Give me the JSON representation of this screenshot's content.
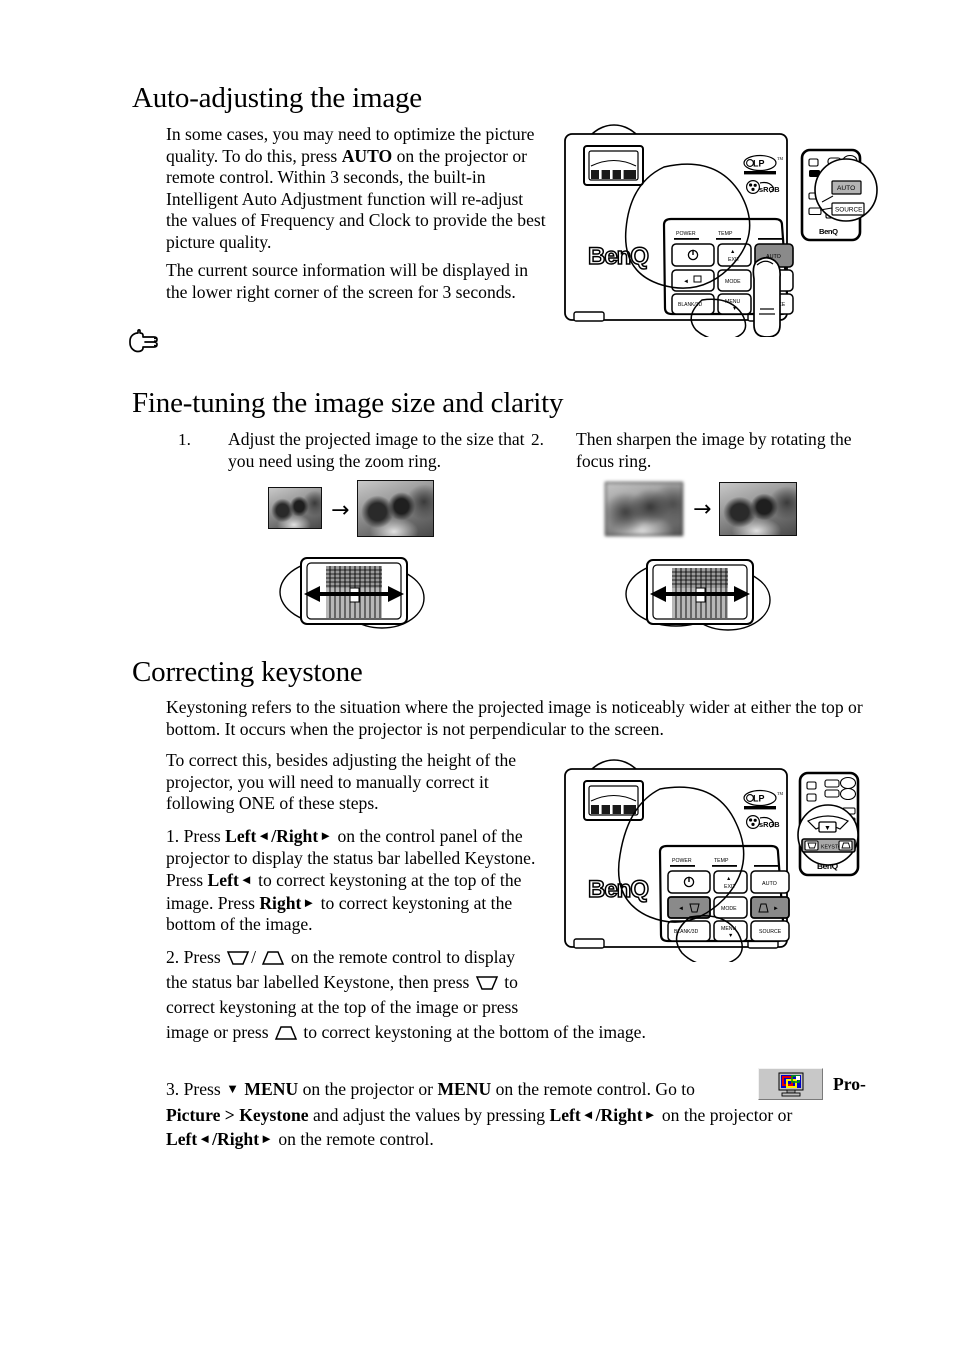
{
  "document": {
    "type": "projector-user-manual-page",
    "product_brand": "BenQ"
  },
  "sections": [
    {
      "id": "auto-adjusting",
      "title": "Auto-adjusting the image",
      "paragraphs": [
        "In some cases, you may need to optimize the picture quality. To do this, press AUTO on the projector or remote control. Within 3 seconds, the built-in Intelligent Auto Adjustment function will re-adjust the values of Frequency and Clock to provide the best picture quality.",
        "The current source information will be displayed in the lower right corner of the screen for 3 seconds."
      ],
      "p1_parts": {
        "a": "In some cases, you may need to optimize the picture quality. To do this, press ",
        "bold": "AUTO",
        "b": " on the projector or remote control. Within 3 seconds, the built-in Intelligent Auto Adjustment function will re-adjust the values of Frequency and Clock to provide the best picture quality."
      },
      "note_glyph": "pointing-hand"
    },
    {
      "id": "fine-tuning",
      "title": "Fine-tuning the image size and clarity",
      "steps": [
        {
          "number": "1.",
          "text": "Adjust the projected image to the size that you need using the zoom ring."
        },
        {
          "number": "2.",
          "text": "Then sharpen the image by rotating the focus ring."
        }
      ],
      "figure_arrow": "→"
    },
    {
      "id": "correcting-keystone",
      "title": "Correcting keystone",
      "intro": "Keystoning refers to the situation where the projected image is noticeably wider at either the top or bottom. It occurs when the projector is not perpendicular to the screen.",
      "lead": "To correct this, besides adjusting the height of the projector, you will need to manually correct it following ONE of these steps.",
      "step1": {
        "a": "1. Press ",
        "b_left": "Left",
        "arrow_left": "◄",
        "b_slash_right": "/Right",
        "arrow_right": "►",
        "c": " on the control panel of the projector to display the status bar labelled Keystone. Press ",
        "d_left": "Left",
        "e": " to correct keystoning at the top of the image. Press ",
        "f_right": "Right",
        "g": " to correct keystoning at the bottom of the image."
      },
      "step2": {
        "a": "2. Press ",
        "slash": "/",
        "b": " on the remote control to display the status bar labelled Keystone, then press ",
        "c": " to correct keystoning at the top of the image or press ",
        "d": " to correct keystoning at the bottom of the image."
      },
      "step3": {
        "a": "3. Press ",
        "down_arrow": "▼",
        "menu1": "MENU",
        "b": " on the projector or ",
        "menu2": "MENU",
        "c": " on the remote control. Go to ",
        "path_pro": "Pro-",
        "path_rest": "Picture > Keystone",
        "d": " and adjust the values by pressing ",
        "left1": "Left",
        "right1": "/Right",
        "e": " on the projector or ",
        "left2": "Left",
        "right2": "/Right",
        "f": " on the remote control."
      }
    }
  ],
  "icons": {
    "menu_button_icon": "display-picture-icon",
    "note_hand": "☞",
    "arrow_left_glyph": "◄",
    "arrow_right_glyph": "►",
    "arrow_down_glyph": "▼",
    "keystone_top_glyph": "trapezoid-narrow-bottom",
    "keystone_bottom_glyph": "trapezoid-narrow-top"
  },
  "illustrations": {
    "projector_auto": {
      "name": "benq-projector-auto-button",
      "brand_label": "BenQ",
      "logos": [
        "DLP",
        "sRGB"
      ],
      "panel_labels": [
        "POWER",
        "TEMP"
      ],
      "buttons": [
        "EXIT",
        "AUTO",
        "MODE",
        "BLANK/3D",
        "MENU",
        "SOURCE"
      ],
      "highlighted_button": "AUTO",
      "remote": {
        "brand_label": "BenQ",
        "magnified_buttons": [
          "AUTO",
          "SOURCE"
        ],
        "highlighted_button": "AUTO"
      }
    },
    "projector_keystone": {
      "name": "benq-projector-keystone-buttons",
      "brand_label": "BenQ",
      "logos": [
        "DLP",
        "sRGB"
      ],
      "panel_labels": [
        "POWER",
        "TEMP"
      ],
      "buttons": [
        "EXIT",
        "AUTO",
        "MODE",
        "BLANK/3D",
        "MENU",
        "SOURCE"
      ],
      "highlighted_buttons": [
        "Left/Keystone",
        "Right/Keystone"
      ],
      "remote": {
        "brand_label": "BenQ",
        "magnified_label": "KEYSTONE"
      }
    },
    "zoom_ring": {
      "name": "zoom-ring-diagram",
      "arrows": "left-right"
    },
    "focus_ring": {
      "name": "focus-ring-diagram",
      "arrows": "left-right"
    }
  },
  "colors": {
    "page_background": "#ffffff",
    "text": "#000000",
    "button_highlight": "#808080",
    "icon_blue": "#0000cc",
    "icon_red": "#e00000",
    "icon_yellow": "#ffee00",
    "icon_green": "#00a000",
    "button_face": "#c8c8c8"
  }
}
